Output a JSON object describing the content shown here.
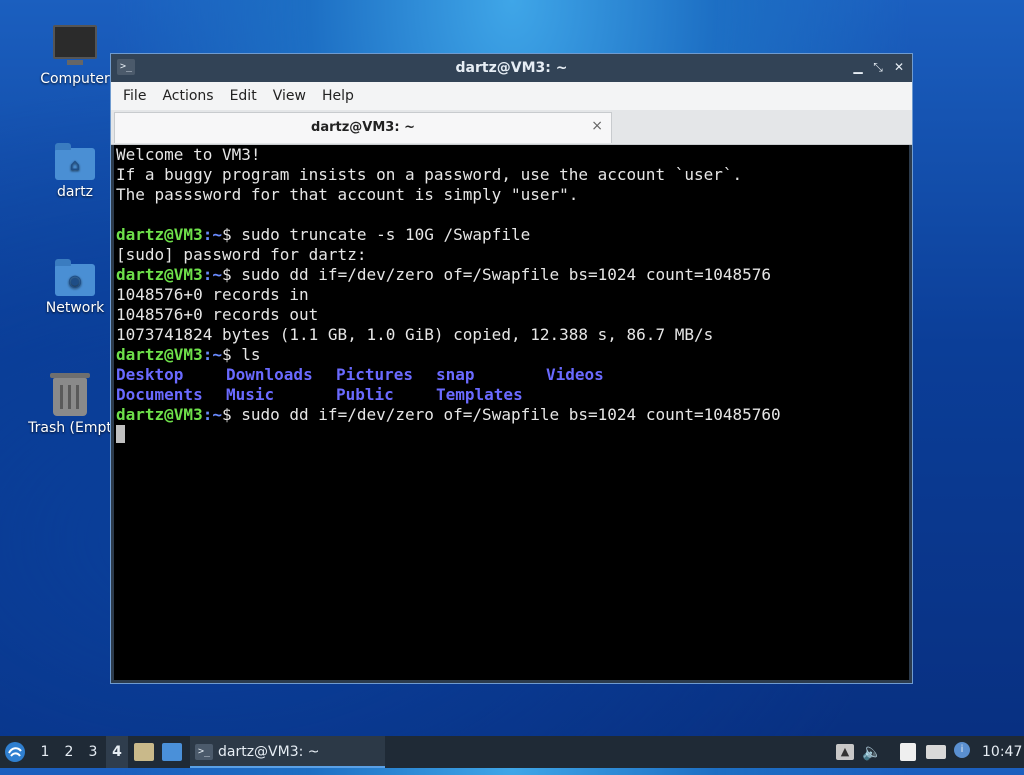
{
  "desktop": {
    "icons": [
      {
        "label": "Computer",
        "icon": "computer-icon"
      },
      {
        "label": "dartz",
        "icon": "home-folder-icon"
      },
      {
        "label": "Network",
        "icon": "network-folder-icon"
      },
      {
        "label": "Trash (Empt",
        "icon": "trash-icon"
      }
    ]
  },
  "window": {
    "title": "dartz@VM3: ~",
    "menu": [
      "File",
      "Actions",
      "Edit",
      "View",
      "Help"
    ],
    "tab_title": "dartz@VM3: ~",
    "tab_close": "×",
    "controls": {
      "minimize": "▁",
      "restore": "⤡",
      "close": "✕"
    }
  },
  "terminal": {
    "prompt_user": "dartz@VM3",
    "prompt_path": ":~",
    "prompt_sign": "$ ",
    "welcome": [
      "Welcome to VM3!",
      "If a buggy program insists on a password, use the account `user`.",
      "The passsword for that account is simply \"user\"."
    ],
    "cmd1": "sudo truncate -s 10G /Swapfile",
    "sudo_prompt": "[sudo] password for dartz:",
    "cmd2": "sudo dd if=/dev/zero of=/Swapfile bs=1024 count=1048576",
    "out1": "1048576+0 records in",
    "out2": "1048576+0 records out",
    "out3": "1073741824 bytes (1.1 GB, 1.0 GiB) copied, 12.388 s, 86.7 MB/s",
    "cmd3": "ls",
    "ls_row1": [
      "Desktop",
      "Downloads",
      "Pictures",
      "snap",
      "Videos"
    ],
    "ls_row2": [
      "Documents",
      "Music",
      "Public",
      "Templates"
    ],
    "cmd4": "sudo dd if=/dev/zero of=/Swapfile bs=1024 count=10485760"
  },
  "taskbar": {
    "workspaces": [
      "1",
      "2",
      "3",
      "4"
    ],
    "active_workspace": "4",
    "task_title": "dartz@VM3: ~",
    "clock": "10:47"
  }
}
